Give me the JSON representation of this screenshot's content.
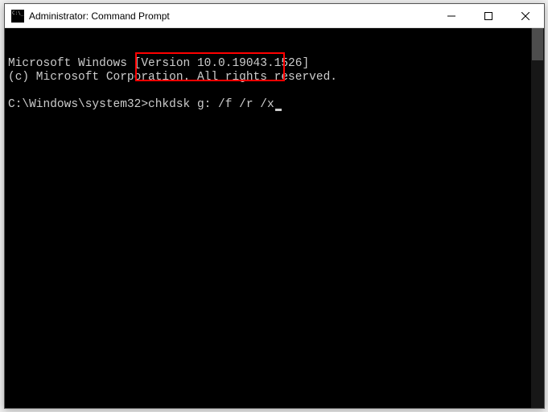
{
  "window": {
    "title": "Administrator: Command Prompt"
  },
  "terminal": {
    "line1": "Microsoft Windows [Version 10.0.19043.1526]",
    "line2": "(c) Microsoft Corporation. All rights reserved.",
    "prompt": "C:\\Windows\\system32>",
    "command": "chkdsk g: /f /r /x"
  }
}
